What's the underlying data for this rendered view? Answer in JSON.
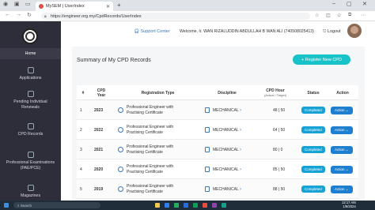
{
  "browser": {
    "tab_title": "MySEM | UserIndex",
    "url": "https://engineer.org.my/CpdRecords/UserIndex"
  },
  "sidebar": {
    "items": [
      {
        "label": "Home"
      },
      {
        "label": "Applications"
      },
      {
        "label": "Pending Individual Renewals"
      },
      {
        "label": "CPD Records"
      },
      {
        "label": "Professional Examinations (PAE/PCE)"
      },
      {
        "label": "Magazines"
      }
    ]
  },
  "header": {
    "support": "Support Center",
    "welcome": "Welcome, Ir. WAN RIZALUDDIN ABDULLAH B WAN ALI (740508025413)",
    "logout": "Logout"
  },
  "panel": {
    "title": "Summary of My CPD Records",
    "register_button": "+ Register New CPD"
  },
  "table": {
    "headers": {
      "no": "#",
      "year_top": "CPD",
      "year_bottom": "Year",
      "registration": "Registration Type",
      "discipline": "Discipline",
      "hour_top": "CPD Hour",
      "hour_bottom": "(Actual / Target)",
      "status": "Status",
      "action": "Action"
    },
    "rows": [
      {
        "no": "1",
        "year": "2023",
        "reg_line1": "Professional Engineer with",
        "reg_line2": "Practising Certificate",
        "discipline": "MECHANICAL",
        "hours": "48 | 50",
        "status": "Completed",
        "action": "Action"
      },
      {
        "no": "2",
        "year": "2022",
        "reg_line1": "Professional Engineer with",
        "reg_line2": "Practising Certificate",
        "discipline": "MECHANICAL",
        "hours": "64 | 50",
        "status": "Completed",
        "action": "Action"
      },
      {
        "no": "3",
        "year": "2021",
        "reg_line1": "Professional Engineer with",
        "reg_line2": "Practising Certificate",
        "discipline": "MECHANICAL",
        "hours": "80 | 0",
        "status": "Completed",
        "action": "Action"
      },
      {
        "no": "4",
        "year": "2020",
        "reg_line1": "Professional Engineer with",
        "reg_line2": "Practising Certificate",
        "discipline": "MECHANICAL",
        "hours": "85 | 50",
        "status": "Completed",
        "action": "Action"
      },
      {
        "no": "5",
        "year": "2019",
        "reg_line1": "Professional Engineer with",
        "reg_line2": "Practising Certificate",
        "discipline": "MECHANICAL",
        "hours": "88 | 50",
        "status": "Completed",
        "action": "Action"
      }
    ]
  },
  "taskbar": {
    "search_placeholder": "Search",
    "time": "12:17 AM",
    "date": "1/9/2024"
  },
  "colors": {
    "sidebar_bg": "#2e2e3a",
    "accent": "#17c3c8",
    "status": "#17a2d6",
    "action": "#1e7fd1"
  }
}
